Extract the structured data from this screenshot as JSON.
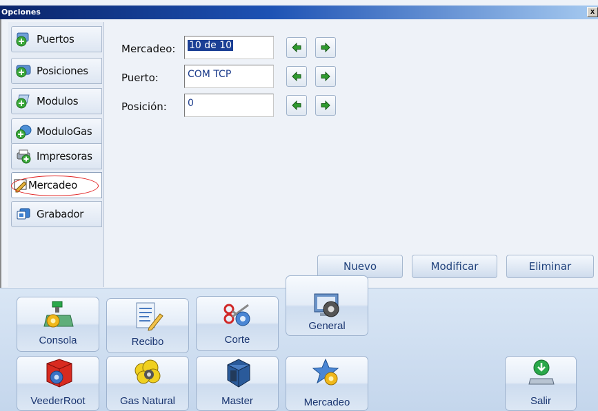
{
  "window": {
    "title": "Opciones",
    "close_label": "x"
  },
  "sidebar": {
    "items": [
      {
        "label": "Puertos",
        "icon": "ports-plus-icon"
      },
      {
        "label": "Posiciones",
        "icon": "positions-plus-icon"
      },
      {
        "label": "Modulos",
        "icon": "modules-plus-icon"
      },
      {
        "label": "ModuloGas",
        "icon": "modulegas-plus-icon"
      },
      {
        "label": "Impresoras",
        "icon": "printer-plus-icon"
      },
      {
        "label": "Mercadeo",
        "icon": "marketing-edit-icon",
        "active": true
      },
      {
        "label": "Grabador",
        "icon": "recorder-icon"
      }
    ]
  },
  "form": {
    "mercadeo_label": "Mercadeo:",
    "mercadeo_value": "10 de 10",
    "puerto_label": "Puerto:",
    "puerto_value": "COM TCP",
    "posicion_label": "Posición:",
    "posicion_value": "0"
  },
  "actions": {
    "nuevo": "Nuevo",
    "modificar": "Modificar",
    "eliminar": "Eliminar"
  },
  "toolbar": {
    "consola": "Consola",
    "recibo": "Recibo",
    "corte": "Corte",
    "general": "General",
    "veederroot": "VeederRoot",
    "gas_natural": "Gas Natural",
    "master": "Master",
    "mercadeo": "Mercadeo",
    "salir": "Salir"
  },
  "colors": {
    "titlebar": "#0a246a",
    "accent": "#1b3f95",
    "arrow_green": "#2e9a2e",
    "highlight_red": "#e02020"
  }
}
